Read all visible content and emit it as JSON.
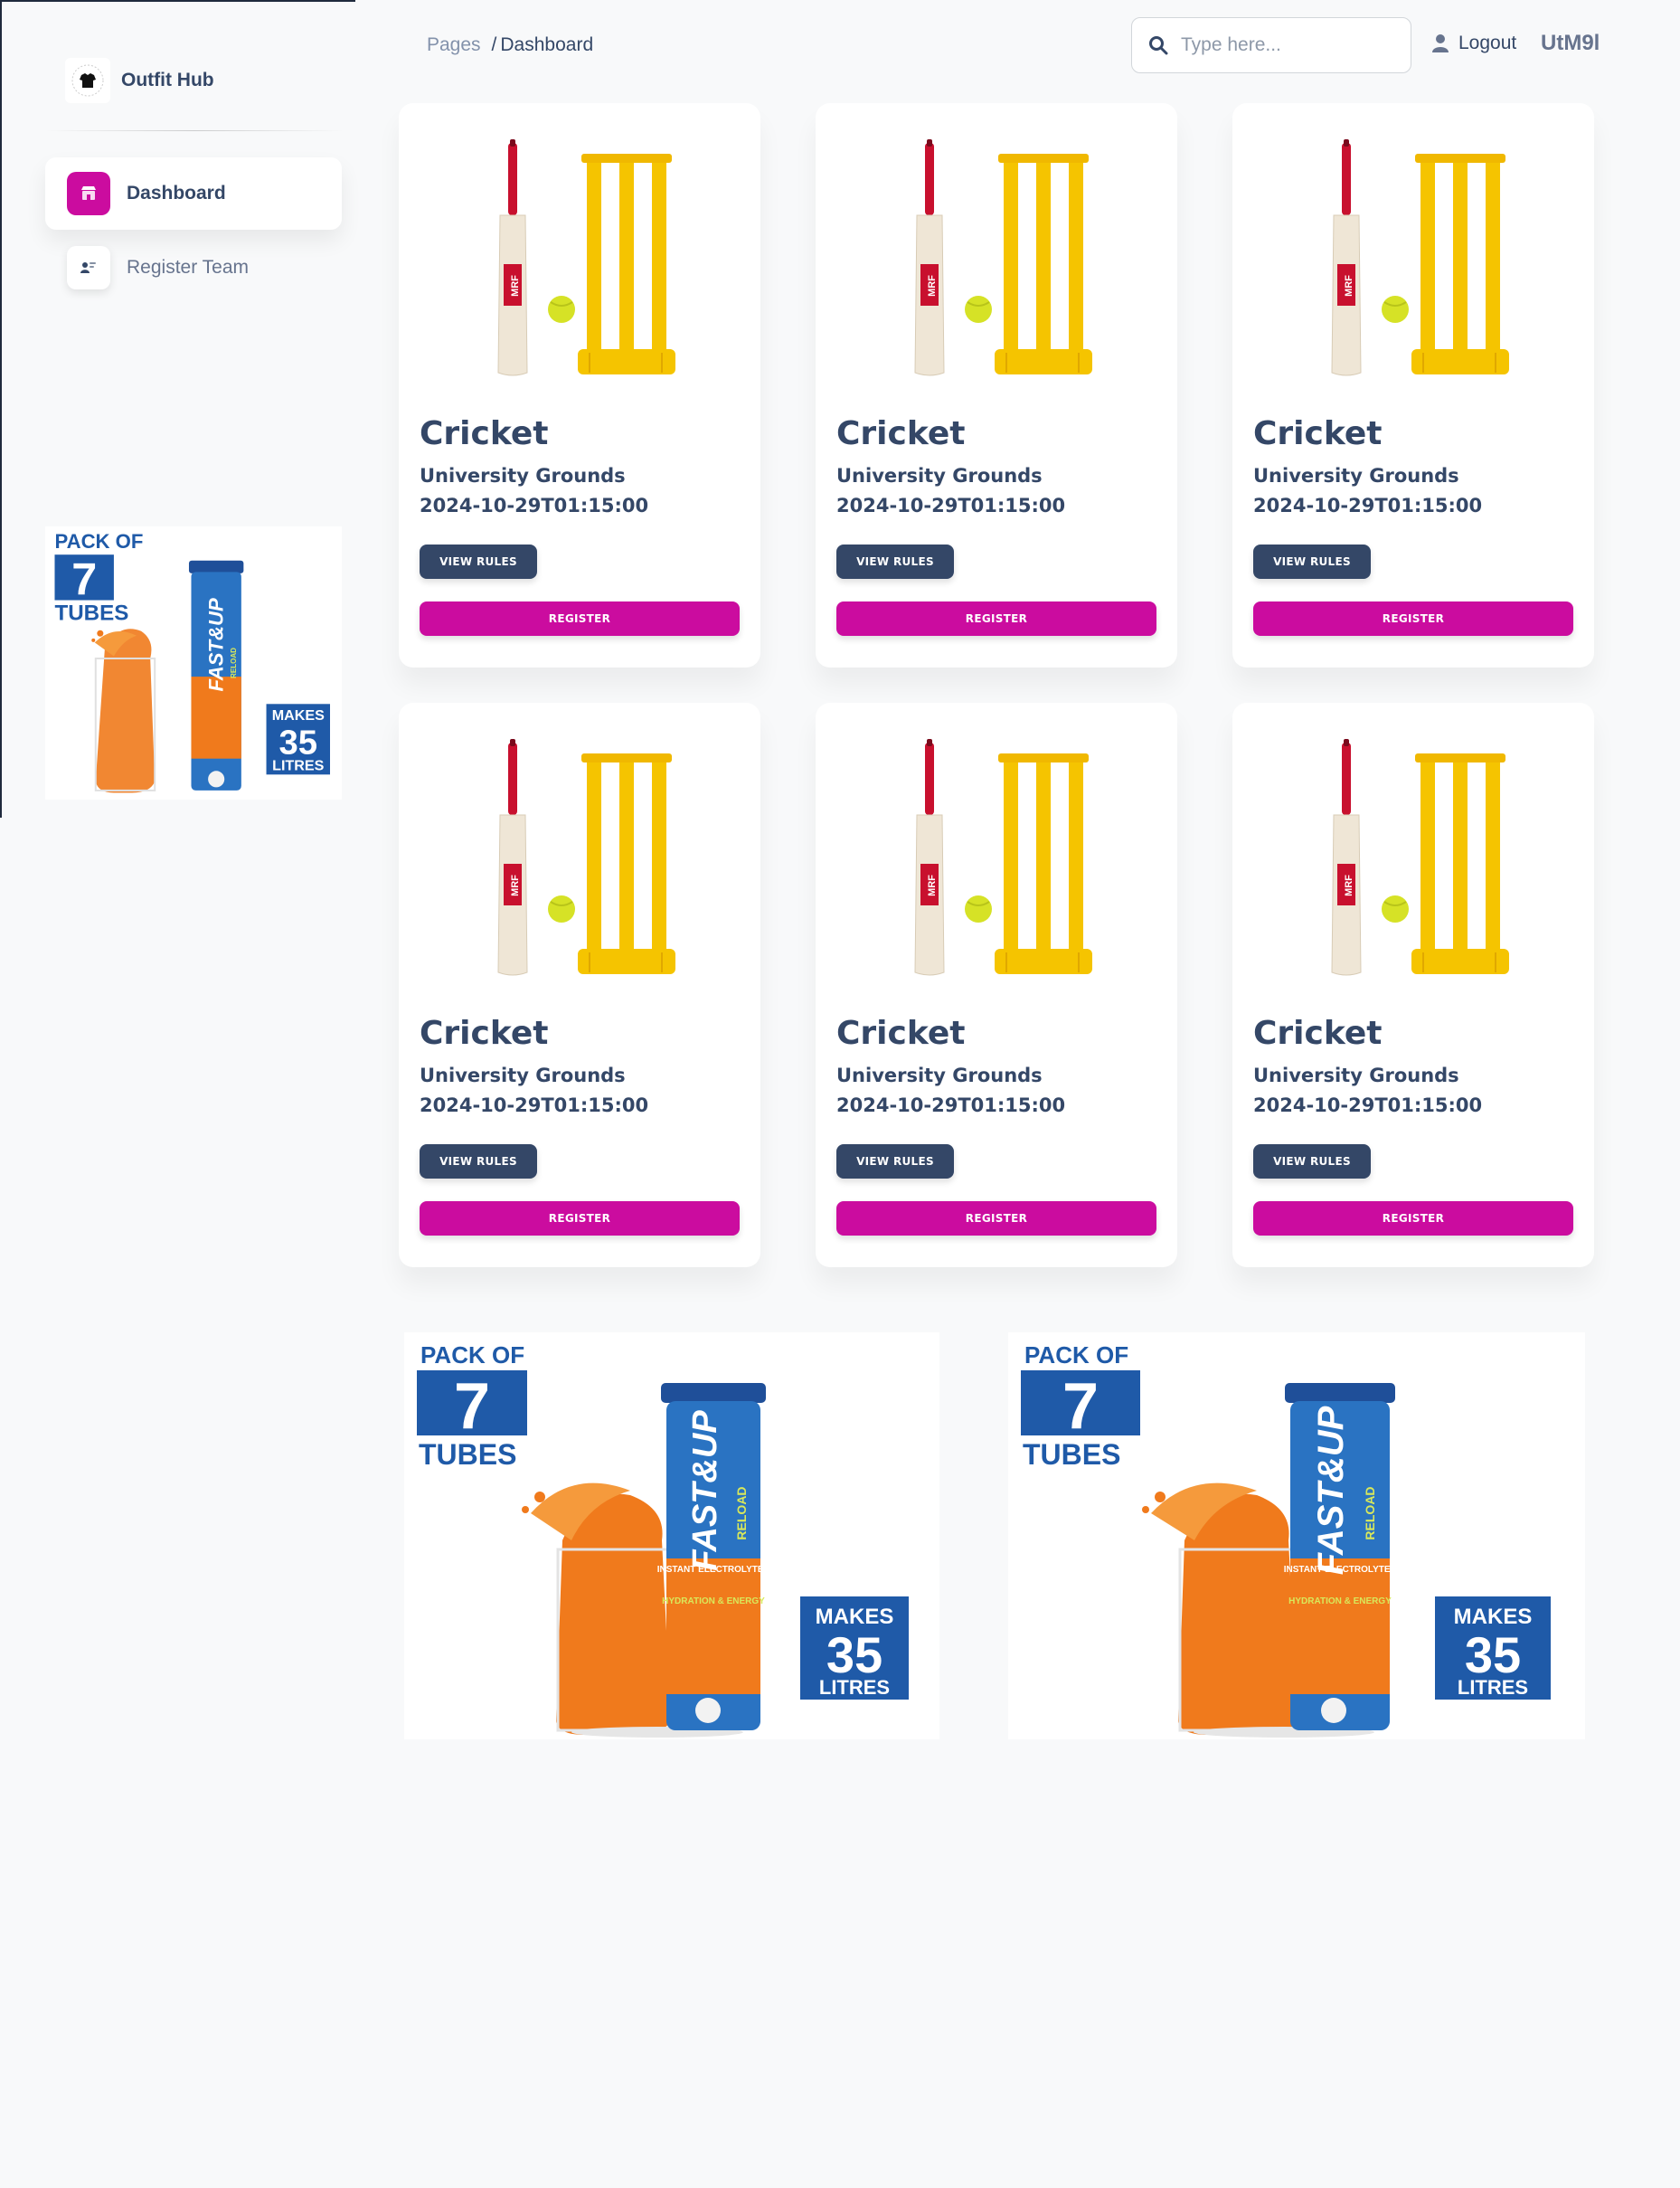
{
  "brand": {
    "name": "Outfit Hub"
  },
  "sidebar": {
    "items": [
      {
        "label": "Dashboard",
        "icon": "shop-icon",
        "active": true
      },
      {
        "label": "Register Team",
        "icon": "team-icon",
        "active": false
      }
    ]
  },
  "breadcrumb": {
    "parent": "Pages",
    "separator": "/",
    "current": "Dashboard"
  },
  "search": {
    "placeholder": "Type here..."
  },
  "header": {
    "logout_label": "Logout",
    "username": "UtM9l"
  },
  "events": [
    {
      "title": "Cricket",
      "venue": "University Grounds",
      "datetime": "2024-10-29T01:15:00",
      "rules_label": "VIEW RULES",
      "register_label": "REGISTER"
    },
    {
      "title": "Cricket",
      "venue": "University Grounds",
      "datetime": "2024-10-29T01:15:00",
      "rules_label": "VIEW RULES",
      "register_label": "REGISTER"
    },
    {
      "title": "Cricket",
      "venue": "University Grounds",
      "datetime": "2024-10-29T01:15:00",
      "rules_label": "VIEW RULES",
      "register_label": "REGISTER"
    },
    {
      "title": "Cricket",
      "venue": "University Grounds",
      "datetime": "2024-10-29T01:15:00",
      "rules_label": "VIEW RULES",
      "register_label": "REGISTER"
    },
    {
      "title": "Cricket",
      "venue": "University Grounds",
      "datetime": "2024-10-29T01:15:00",
      "rules_label": "VIEW RULES",
      "register_label": "REGISTER"
    },
    {
      "title": "Cricket",
      "venue": "University Grounds",
      "datetime": "2024-10-29T01:15:00",
      "rules_label": "VIEW RULES",
      "register_label": "REGISTER"
    }
  ],
  "ad": {
    "pack_of": "PACK OF",
    "count": "7",
    "tubes": "TUBES",
    "brand": "FAST&UP",
    "sub_brand": "RELOAD",
    "makes": "MAKES",
    "litres_count": "35",
    "litres": "LITRES",
    "tagline": "INSTANT ELECTROLYTES",
    "tagline2": "HYDRATION & ENERGY"
  },
  "colors": {
    "primary": "#cb0c9f",
    "dark": "#344767",
    "muted": "#67748e",
    "ad_blue": "#1f5aa8",
    "ad_orange": "#f07a1c",
    "wicket_yellow": "#f5c400"
  }
}
